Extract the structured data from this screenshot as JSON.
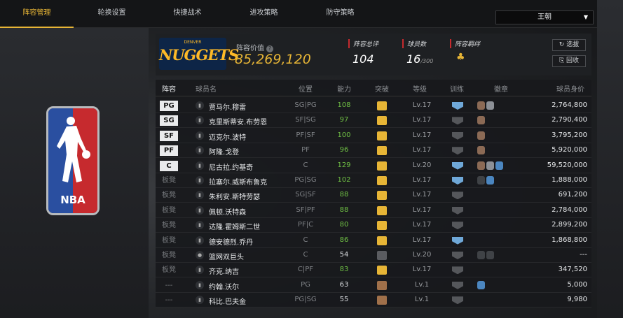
{
  "nav": {
    "tabs": [
      "阵容管理",
      "轮换设置",
      "快捷战术",
      "进攻策略",
      "防守策略"
    ],
    "active_tab": 0,
    "team_select": "王朝"
  },
  "logo": {
    "text": "NBA"
  },
  "team": {
    "logo_small": "DENVER",
    "logo_word": "NUGGETS",
    "value_label": "阵容价值",
    "value": "85,269,120"
  },
  "stats": {
    "overall_label": "阵容总评",
    "overall": "104",
    "count_label": "球员数",
    "count": "16",
    "count_max": "/300",
    "bond_label": "阵容羁绊"
  },
  "buttons": {
    "select": "选拔",
    "recycle": "回收"
  },
  "table": {
    "headers": {
      "lineup": "阵容",
      "name": "球员名",
      "position": "位置",
      "rating": "能力",
      "breakthrough": "突破",
      "level": "等级",
      "training": "训练",
      "badges": "徽章",
      "worth": "球员身价"
    },
    "rows": [
      {
        "lineup": "PG",
        "name": "贾马尔.穆雷",
        "position": "SG|PG",
        "rating": "108",
        "level": "Lv.17",
        "worth": "2,764,800"
      },
      {
        "lineup": "SG",
        "name": "克里斯蒂安.布劳恩",
        "position": "SF|SG",
        "rating": "97",
        "level": "Lv.17",
        "worth": "2,790,400"
      },
      {
        "lineup": "SF",
        "name": "迈克尔.波特",
        "position": "PF|SF",
        "rating": "100",
        "level": "Lv.17",
        "worth": "3,795,200"
      },
      {
        "lineup": "PF",
        "name": "阿隆.戈登",
        "position": "PF",
        "rating": "96",
        "level": "Lv.17",
        "worth": "5,920,000"
      },
      {
        "lineup": "C",
        "name": "尼古拉.约基奇",
        "position": "C",
        "rating": "129",
        "level": "Lv.20",
        "worth": "59,520,000"
      },
      {
        "lineup": "板凳",
        "name": "拉塞尔.威斯布鲁克",
        "position": "PG|SG",
        "rating": "102",
        "level": "Lv.17",
        "worth": "1,888,000"
      },
      {
        "lineup": "板凳",
        "name": "朱利安.斯特劳瑟",
        "position": "SG|SF",
        "rating": "88",
        "level": "Lv.17",
        "worth": "691,200"
      },
      {
        "lineup": "板凳",
        "name": "佩顿.沃特森",
        "position": "SF|PF",
        "rating": "88",
        "level": "Lv.17",
        "worth": "2,784,000"
      },
      {
        "lineup": "板凳",
        "name": "达隆.霍姆斯二世",
        "position": "PF|C",
        "rating": "80",
        "level": "Lv.17",
        "worth": "2,899,200"
      },
      {
        "lineup": "板凳",
        "name": "德安德烈.乔丹",
        "position": "C",
        "rating": "86",
        "level": "Lv.17",
        "worth": "1,868,800"
      },
      {
        "lineup": "板凳",
        "name": "篮网双巨头",
        "position": "C",
        "rating": "54",
        "level": "Lv.20",
        "worth": "---"
      },
      {
        "lineup": "板凳",
        "name": "齐克.纳吉",
        "position": "C|PF",
        "rating": "83",
        "level": "Lv.17",
        "worth": "347,520"
      },
      {
        "lineup": "---",
        "name": "约翰.沃尔",
        "position": "PG",
        "rating": "63",
        "level": "Lv.1",
        "worth": "5,000"
      },
      {
        "lineup": "---",
        "name": "科比.巴夫金",
        "position": "PG|SG",
        "rating": "55",
        "level": "Lv.1",
        "worth": "9,980"
      }
    ]
  },
  "colors": {
    "accent": "#e7b536",
    "green": "#6fbf44",
    "red": "#c62a2e",
    "training_on": "#6fa8d8"
  }
}
